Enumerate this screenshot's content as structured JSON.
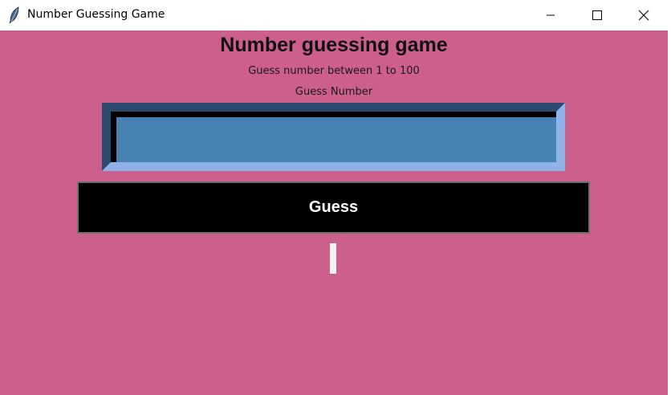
{
  "window": {
    "title": "Number Guessing Game",
    "icon": "feather-icon",
    "controls": [
      "minimize-icon",
      "maximize-icon",
      "close-icon"
    ]
  },
  "app": {
    "heading": "Number guessing game",
    "subheading": "Guess number between 1 to 100",
    "field_label": "Guess Number",
    "input_value": "",
    "button_label": "Guess",
    "result_text": ""
  },
  "colors": {
    "background": "#cd5f8d",
    "input_bg": "#4682b4",
    "button_bg": "#000000",
    "button_text": "#ffffff"
  }
}
